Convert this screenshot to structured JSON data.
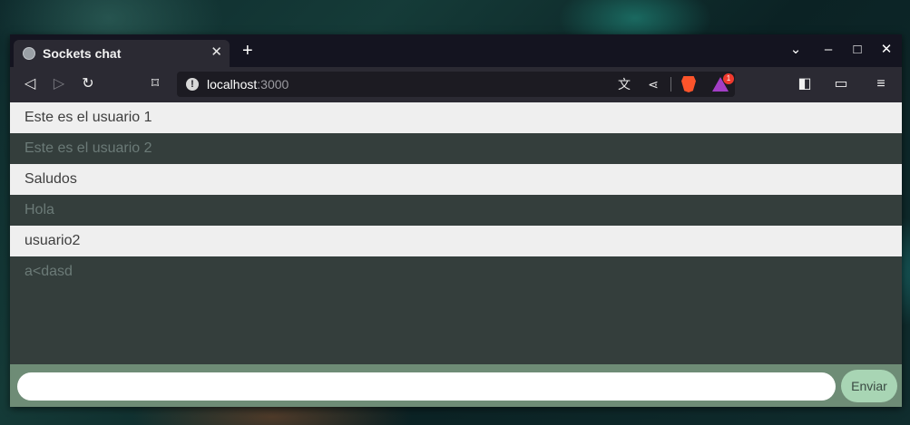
{
  "browser": {
    "tab": {
      "title": "Sockets chat",
      "close_glyph": "✕",
      "favicon": "globe-icon"
    },
    "new_tab_glyph": "+",
    "window_controls": {
      "menu_glyph": "⌄",
      "minimize_glyph": "–",
      "maximize_glyph": "□",
      "close_glyph": "✕"
    },
    "toolbar": {
      "back_glyph": "◁",
      "forward_glyph": "▷",
      "reload_glyph": "↻",
      "bookmark_glyph": "⌑",
      "sidebar_glyph": "◧",
      "wallet_glyph": "▭",
      "menu_glyph": "≡"
    },
    "url": {
      "host": "localhost",
      "port": ":3000",
      "info_glyph": "!",
      "translate_glyph": "文",
      "share_glyph": "⋖",
      "rewards_badge": "1"
    }
  },
  "chat": {
    "messages": [
      {
        "text": "Este es el usuario 1",
        "style": "light"
      },
      {
        "text": "Este es el usuario 2",
        "style": "dark"
      },
      {
        "text": "Saludos",
        "style": "light"
      },
      {
        "text": "Hola",
        "style": "dark"
      },
      {
        "text": "usuario2",
        "style": "light"
      },
      {
        "text": "a<dasd",
        "style": "dark"
      }
    ],
    "input": {
      "value": "",
      "placeholder": ""
    },
    "send_label": "Enviar"
  },
  "colors": {
    "page_background": "#343e3c",
    "light_row": "#efefef",
    "form_bar": "#6e8c76",
    "send_button": "#a8d5b4",
    "brave_accent": "#fb542b"
  }
}
